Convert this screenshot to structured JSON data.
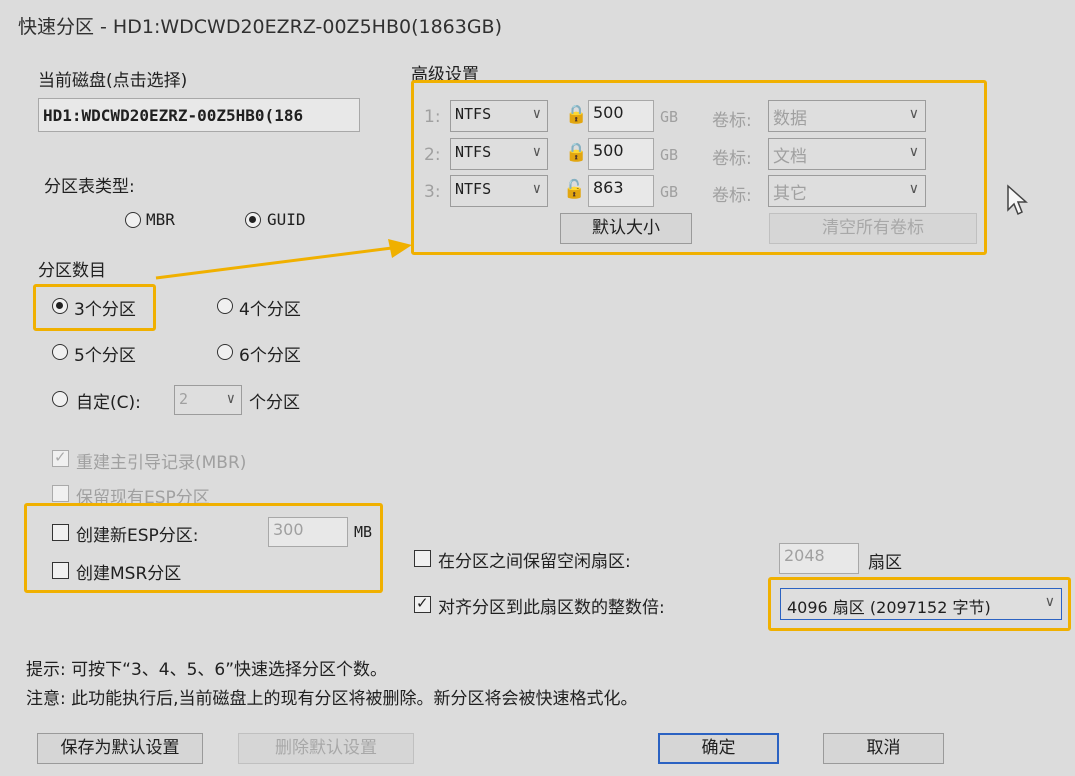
{
  "window": {
    "title": "快速分区 - HD1:WDCWD20EZRZ-00Z5HB0(1863GB)"
  },
  "current_disk": {
    "label": "当前磁盘(点击选择)",
    "value": "HD1:WDCWD20EZRZ-00Z5HB0(186"
  },
  "partition_table": {
    "label": "分区表类型:",
    "options": [
      {
        "label": "MBR",
        "selected": false
      },
      {
        "label": "GUID",
        "selected": true
      }
    ]
  },
  "partition_count": {
    "label": "分区数目",
    "options": [
      {
        "label": "3个分区",
        "selected": true
      },
      {
        "label": "4个分区",
        "selected": false
      },
      {
        "label": "5个分区",
        "selected": false
      },
      {
        "label": "6个分区",
        "selected": false
      },
      {
        "label": "自定(C):",
        "selected": false
      }
    ],
    "custom_value": "2",
    "custom_suffix": "个分区"
  },
  "options": {
    "rebuild_mbr": {
      "label": "重建主引导记录(MBR)",
      "checked": true,
      "disabled": true
    },
    "keep_esp": {
      "label": "保留现有ESP分区",
      "checked": false,
      "disabled": true
    },
    "create_esp": {
      "label": "创建新ESP分区:",
      "checked": false,
      "size": "300",
      "unit": "MB"
    },
    "create_msr": {
      "label": "创建MSR分区",
      "checked": false
    }
  },
  "advanced": {
    "label": "高级设置",
    "rows": [
      {
        "index": "1:",
        "fs": "NTFS",
        "lock": "locked",
        "size": "500",
        "unit": "GB",
        "vol_label": "卷标:",
        "vol_value": "数据"
      },
      {
        "index": "2:",
        "fs": "NTFS",
        "lock": "locked",
        "size": "500",
        "unit": "GB",
        "vol_label": "卷标:",
        "vol_value": "文档"
      },
      {
        "index": "3:",
        "fs": "NTFS",
        "lock": "unlocked",
        "size": "863",
        "unit": "GB",
        "vol_label": "卷标:",
        "vol_value": "其它"
      }
    ],
    "default_size_button": "默认大小",
    "clear_labels_button": "清空所有卷标"
  },
  "reserve": {
    "label": "在分区之间保留空闲扇区:",
    "checked": false,
    "value": "2048",
    "unit": "扇区"
  },
  "align": {
    "label": "对齐分区到此扇区数的整数倍:",
    "checked": true,
    "value": "4096 扇区 (2097152 字节)"
  },
  "hints": {
    "tip": "提示: 可按下“3、4、5、6”快速选择分区个数。",
    "note": "注意: 此功能执行后,当前磁盘上的现有分区将被删除。新分区将会被快速格式化。"
  },
  "buttons": {
    "save_default": "保存为默认设置",
    "delete_default": "删除默认设置",
    "ok": "确定",
    "cancel": "取消"
  },
  "colors": {
    "highlight": "#f0b000",
    "focus": "#2b62c2"
  }
}
